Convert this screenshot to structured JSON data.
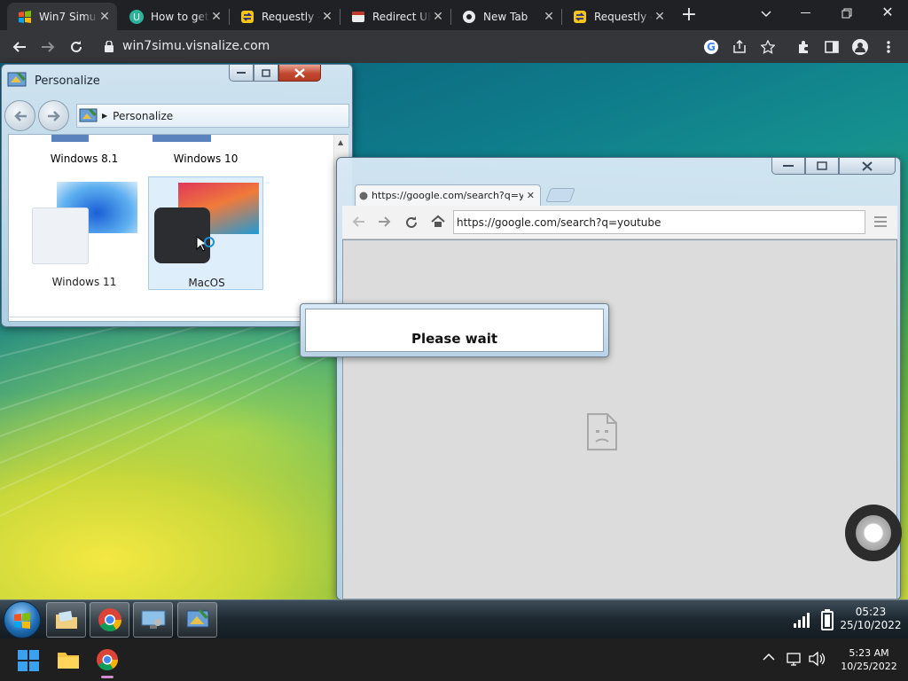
{
  "host_browser": {
    "tabs": [
      {
        "title": "Win7 Simu",
        "favicon": "win7-icon",
        "active": true
      },
      {
        "title": "How to get",
        "favicon": "u-icon"
      },
      {
        "title": "Requestly -",
        "favicon": "requestly-icon"
      },
      {
        "title": "Redirect UR",
        "favicon": "redirect-icon"
      },
      {
        "title": "New Tab",
        "favicon": "chrome-icon"
      },
      {
        "title": "Requestly -",
        "favicon": "requestly-icon"
      }
    ],
    "address": "win7simu.visnalize.com"
  },
  "personalize_window": {
    "title": "Personalize",
    "breadcrumb": "Personalize",
    "themes": [
      {
        "label": "Windows 8.1"
      },
      {
        "label": "Windows 10"
      },
      {
        "label": "Windows 11"
      },
      {
        "label": "MacOS",
        "selected": true
      }
    ]
  },
  "emulated_browser": {
    "tab_title": "https://google.com/search?q=youtube",
    "address": "https://google.com/search?q=youtube"
  },
  "dialog": {
    "message": "Please wait"
  },
  "win7_taskbar": {
    "time": "05:23",
    "date": "25/10/2022",
    "pinned": [
      "explorer-icon",
      "chrome-icon",
      "display-icon",
      "personalize-icon"
    ]
  },
  "host_taskbar": {
    "time": "5:23 AM",
    "date": "10/25/2022"
  },
  "colors": {
    "host_tab_bg": "#35363a",
    "win7_close": "#c3472e",
    "win11_bar": "#1f1f1f"
  }
}
